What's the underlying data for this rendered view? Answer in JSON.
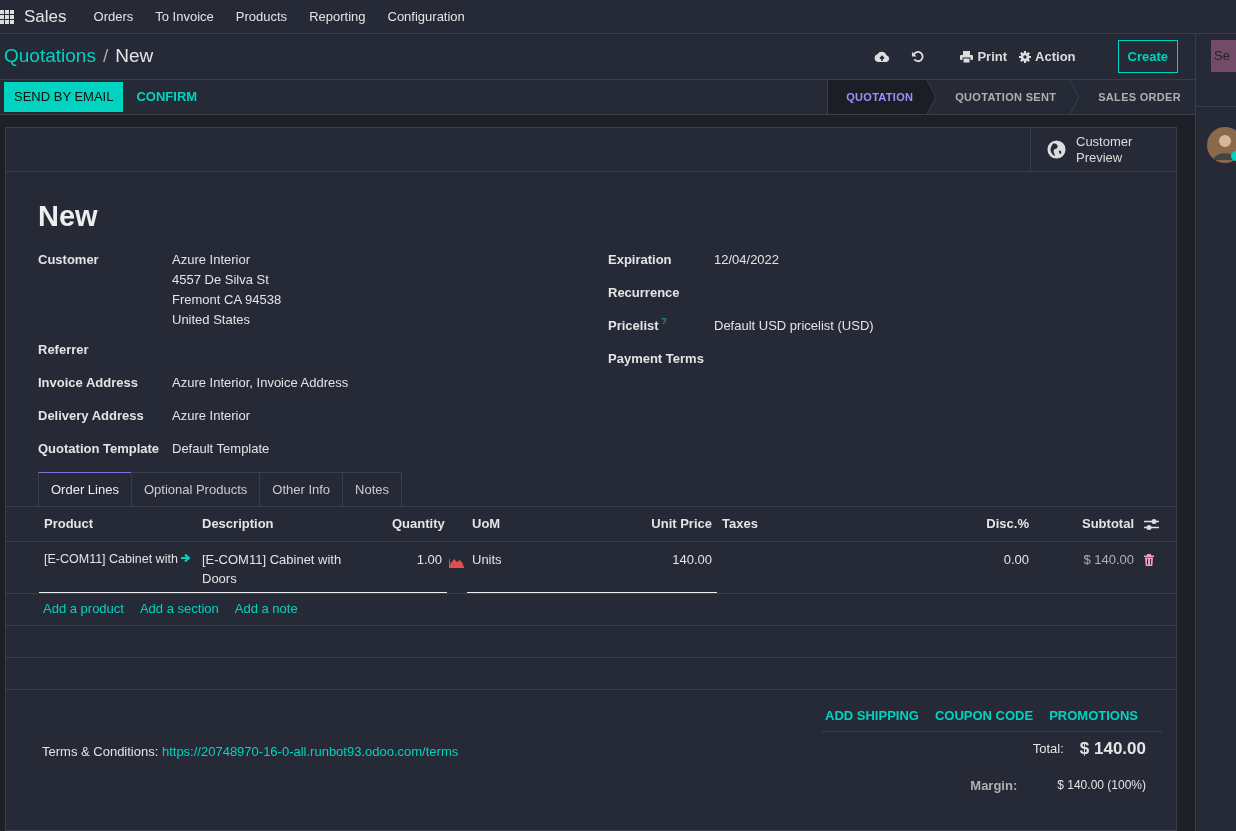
{
  "navbar": {
    "app": "Sales",
    "menu": [
      "Orders",
      "To Invoice",
      "Products",
      "Reporting",
      "Configuration"
    ]
  },
  "breadcrumb": {
    "parent": "Quotations",
    "separator": "/",
    "current": "New"
  },
  "control_panel": {
    "print": "Print",
    "action": "Action",
    "create": "Create"
  },
  "buttons": [
    {
      "label": "SEND BY EMAIL",
      "kind": "primary"
    },
    {
      "label": "CONFIRM",
      "kind": "link"
    }
  ],
  "statusbar": [
    {
      "label": "QUOTATION",
      "selected": true
    },
    {
      "label": "QUOTATION SENT",
      "selected": false
    },
    {
      "label": "SALES ORDER",
      "selected": false
    }
  ],
  "smart_button": {
    "label": "Customer Preview"
  },
  "title": "New",
  "left_fields": [
    {
      "label": "Customer",
      "lines": [
        "Azure Interior",
        "4557 De Silva St",
        "Fremont CA 94538",
        "United States"
      ]
    },
    {
      "label": "Referrer"
    },
    {
      "label": "Invoice Address",
      "lines": [
        "Azure Interior, Invoice Address"
      ]
    },
    {
      "label": "Delivery Address",
      "lines": [
        "Azure Interior"
      ]
    },
    {
      "label": "Quotation Template",
      "lines": [
        "Default Template"
      ]
    }
  ],
  "right_fields": [
    {
      "label": "Expiration",
      "value": "12/04/2022"
    },
    {
      "label": "Recurrence"
    },
    {
      "label": "Pricelist",
      "help": "?",
      "value": "Default USD pricelist (USD)"
    },
    {
      "label": "Payment Terms"
    }
  ],
  "tabs": [
    {
      "label": "Order Lines",
      "selected": true
    },
    {
      "label": "Optional Products",
      "selected": false
    },
    {
      "label": "Other Info",
      "selected": false
    },
    {
      "label": "Notes",
      "selected": false
    }
  ],
  "order_lines": {
    "columns": [
      "Product",
      "Description",
      "Quantity",
      "UoM",
      "Unit Price",
      "Taxes",
      "Disc.%",
      "Subtotal"
    ],
    "rows": [
      {
        "product": "[E-COM11] Cabinet with",
        "description": "[E-COM11] Cabinet with Doors",
        "quantity": "1.00",
        "uom": "Units",
        "unit_price": "140.00",
        "discount": "0.00",
        "subtotal": "$ 140.00"
      }
    ],
    "add_links": [
      "Add a product",
      "Add a section",
      "Add a note"
    ]
  },
  "footer": {
    "actions": [
      "ADD SHIPPING",
      "COUPON CODE",
      "PROMOTIONS"
    ],
    "terms_label": "Terms & Conditions:",
    "terms_link": "https://20748970-16-0-all.runbot93.odoo.com/terms",
    "total_label": "Total:",
    "total": "$ 140.00",
    "margin_label": "Margin:",
    "margin": "$ 140.00 (100%)"
  },
  "chatter": {
    "button": "Se"
  }
}
